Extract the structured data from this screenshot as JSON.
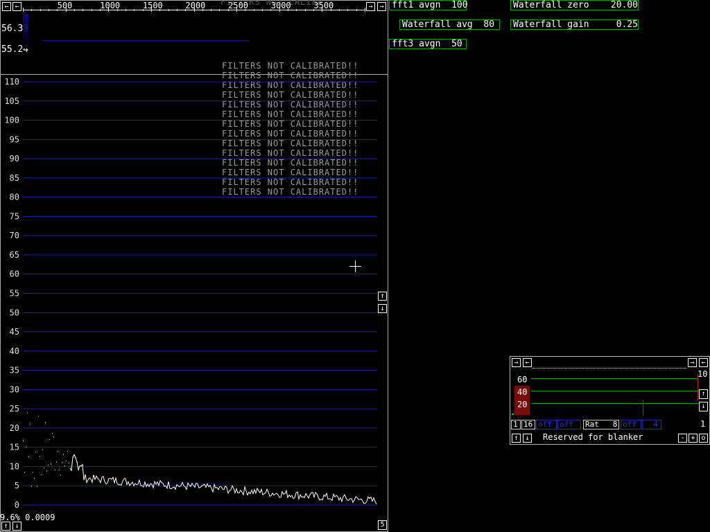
{
  "ruler": {
    "left_arrow": "←",
    "right_arrow": "→",
    "labels": [
      "500",
      "1000",
      "1500",
      "2000",
      "2500",
      "3000",
      "3500"
    ],
    "overlay_text": "FILTERS NOT CALIBR !"
  },
  "waterfall": {
    "top_value": "56.39",
    "bottom_value": "55.24"
  },
  "spectrum": {
    "warning_text": "FILTERS NOT CALIBRATED!!",
    "y_ticks": [
      "110",
      "105",
      "100",
      "95",
      "90",
      "85",
      "80",
      "75",
      "70",
      "65",
      "60",
      "55",
      "50",
      "45",
      "40",
      "35",
      "30",
      "25",
      "20",
      "15",
      "10",
      "5",
      "0"
    ],
    "status_readout": "9.6% 0.0009",
    "scroll_up": "↑",
    "scroll_down": "↓",
    "mode_value": "5",
    "trace_color": "#ffffff",
    "grid_color": "#1a22a8"
  },
  "params": {
    "fft1_avgn": "fft1 avgn  100",
    "waterfall_avg": "Waterfall avg  80",
    "fft3_avgn": "fft3 avgn  50",
    "waterfall_zero": "Waterfall zero    20.00",
    "waterfall_gain": "Waterfall gain     0.25",
    "param_border_color": "#1e9a1e"
  },
  "mini_panel": {
    "left_arrow": "→",
    "left_arrow2": "←",
    "right_arrow": "→",
    "right_arrow2": "←",
    "scale_top_right": "10",
    "level_labels": [
      "60",
      "40",
      "20"
    ],
    "bottom_row": {
      "cell1": "1",
      "cell2": "16",
      "off1": "off",
      "off2": "off",
      "rat": "Rat   8",
      "off3": "off",
      "dash": "  4",
      "right_value": "1"
    },
    "blanker_text": "Reserved for blanker",
    "btn_minus": "-",
    "btn_plus": "+",
    "btn_o": "o",
    "up": "↑",
    "down": "↓",
    "side_up": "↑",
    "side_down": "↓",
    "highlight_color": "#7a0a0a",
    "line_color": "#1e9a1e"
  }
}
